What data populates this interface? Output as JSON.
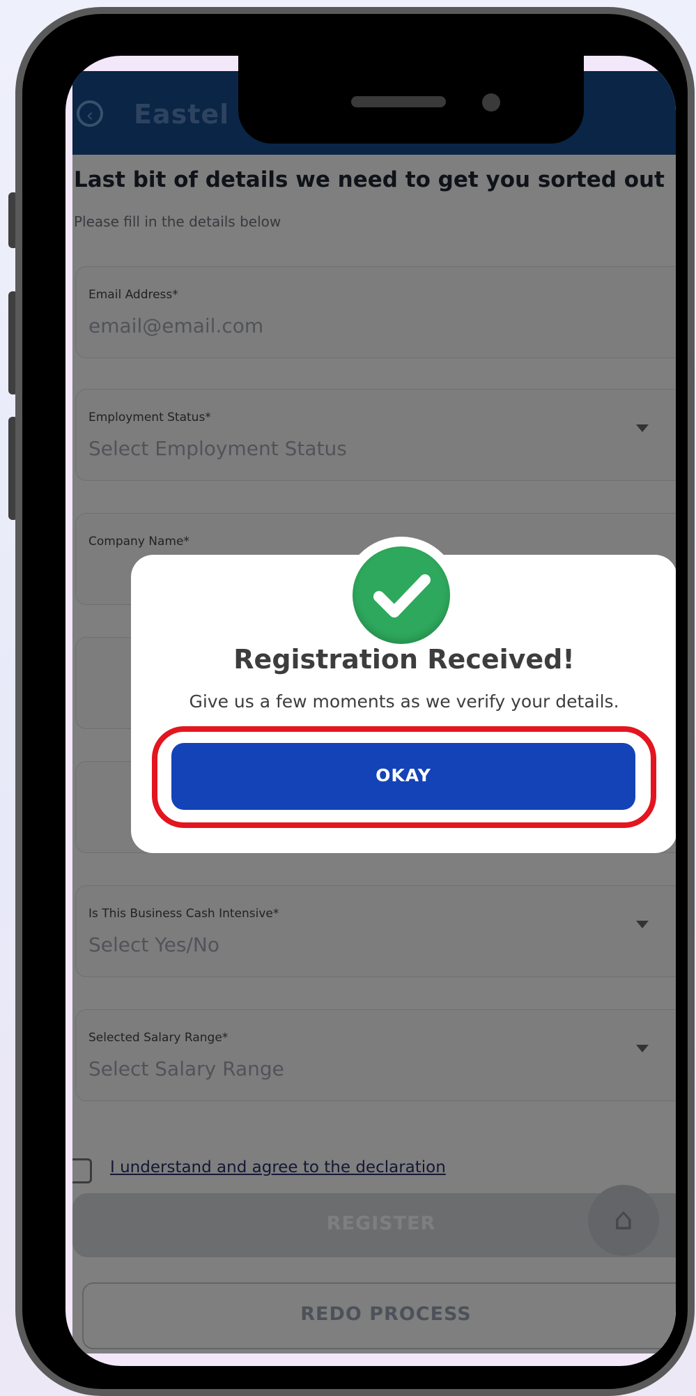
{
  "app": {
    "title": "Eastel Wallet Activation",
    "back_icon": "arrow-left-icon",
    "heading": "Last bit of details we need to get you sorted out",
    "subheading": "Please fill in the details below"
  },
  "form": {
    "fields": [
      {
        "label": "Email Address*",
        "value": "email@email.com"
      },
      {
        "label": "Employment Status*",
        "value": "Select Employment Status"
      },
      {
        "label": "Company Name*",
        "value": ""
      },
      {
        "label": "",
        "value": ""
      },
      {
        "label": "",
        "value": ""
      },
      {
        "label": "Is This Business Cash Intensive*",
        "value": "Select Yes/No"
      },
      {
        "label": "Selected Salary Range*",
        "value": "Select Salary Range"
      }
    ],
    "declaration": "I understand and agree to the declaration",
    "register_label": "REGISTER",
    "redo_label": "REDO PROCESS",
    "home_icon": "home-icon"
  },
  "modal": {
    "icon": "check-circle-icon",
    "title": "Registration Received!",
    "message": "Give us a few moments as we verify your details.",
    "okay_label": "OKAY",
    "highlight_color": "#e3151f",
    "button_color": "#1443b8",
    "success_color": "#2ea85c"
  }
}
